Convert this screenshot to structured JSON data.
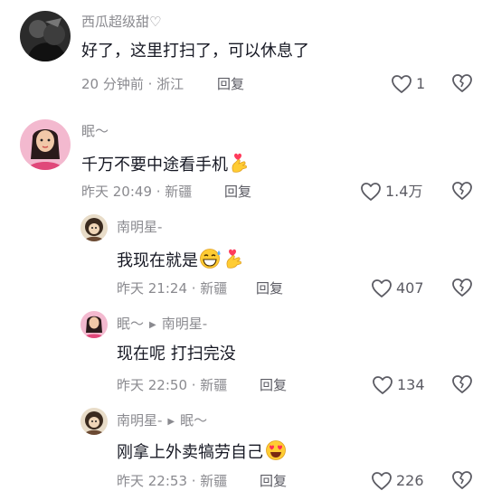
{
  "colors": {
    "text_primary": "#161823",
    "text_secondary": "#8a8a8f",
    "icon": "#5b5b63"
  },
  "comments": [
    {
      "username": "西瓜超级甜♡",
      "text": "好了，这里打扫了，可以休息了",
      "time": "20 分钟前 · 浙江",
      "reply_label": "回复",
      "likes": "1",
      "avatar_icon": "dark-bw-avatar"
    },
    {
      "username": "眠～",
      "text": "千万不要中途看手机",
      "emoji": [
        "heart-hand-emoji"
      ],
      "time": "昨天 20:49 · 新疆",
      "reply_label": "回复",
      "likes": "1.4万",
      "avatar_icon": "pink-doll-avatar"
    }
  ],
  "replies": [
    {
      "username": "南明星-",
      "text": "我现在就是",
      "emoji": [
        "grinning-sweat-emoji",
        "heart-hand-emoji"
      ],
      "time": "昨天 21:24 · 新疆",
      "reply_label": "回复",
      "likes": "407",
      "avatar_icon": "brown-character-avatar"
    },
    {
      "username": "眠～",
      "reply_to": "南明星-",
      "text": "现在呢 打扫完没",
      "time": "昨天 22:50 · 新疆",
      "reply_label": "回复",
      "likes": "134",
      "avatar_icon": "pink-doll-avatar"
    },
    {
      "username": "南明星-",
      "reply_to": "眠～",
      "text": "刚拿上外卖犒劳自己",
      "emoji": [
        "heart-eyes-emoji"
      ],
      "time": "昨天 22:53 · 新疆",
      "reply_label": "回复",
      "likes": "226",
      "avatar_icon": "brown-character-avatar"
    }
  ]
}
